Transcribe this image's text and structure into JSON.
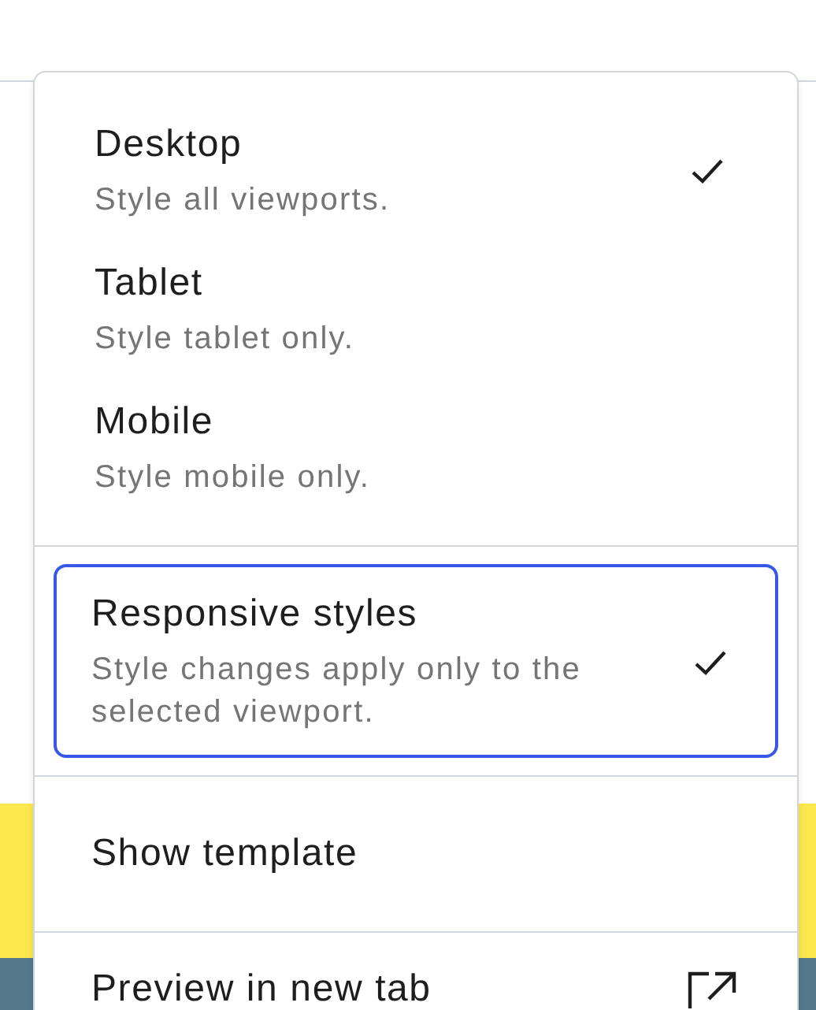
{
  "menu": {
    "sections": [
      {
        "items": [
          {
            "kind": "option",
            "label": "Desktop",
            "description": "Style all viewports.",
            "checked": true,
            "focused": false
          },
          {
            "kind": "option",
            "label": "Tablet",
            "description": "Style tablet only.",
            "checked": false,
            "focused": false
          },
          {
            "kind": "option",
            "label": "Mobile",
            "description": "Style mobile only.",
            "checked": false,
            "focused": false
          }
        ]
      },
      {
        "items": [
          {
            "kind": "option",
            "label": "Responsive styles",
            "description": "Style changes apply only to the selected viewport.",
            "checked": true,
            "focused": true
          }
        ]
      },
      {
        "items": [
          {
            "kind": "action",
            "label": "Show template",
            "checked": false,
            "focused": false
          }
        ]
      },
      {
        "items": [
          {
            "kind": "link",
            "label": "Preview in new tab",
            "checked": false,
            "focused": false
          }
        ]
      }
    ]
  }
}
